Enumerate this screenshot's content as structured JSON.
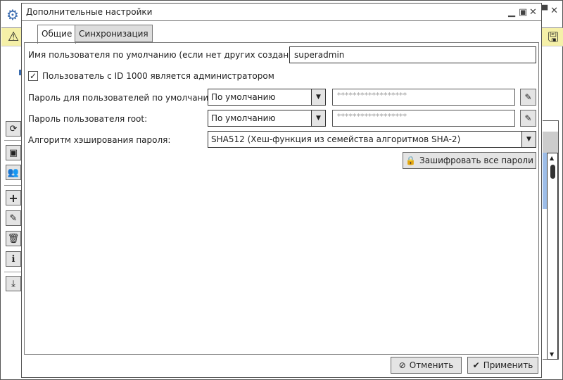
{
  "background_app": {
    "icons": [
      "gear-icon",
      "warning-icon",
      "save-lock-icon"
    ],
    "toolbar": [
      "refresh-icon",
      "contact-card-icon",
      "users-icon",
      "plus-icon",
      "edit-icon",
      "trash-icon",
      "info-icon",
      "download-icon"
    ],
    "highlight_color": "#f5f0a8"
  },
  "dialog": {
    "title": "Дополнительные настройки",
    "tabs": [
      {
        "label": "Общие",
        "active": true
      },
      {
        "label": "Синхронизация",
        "active": false
      }
    ],
    "general": {
      "default_user_label": "Имя пользователя по умолчанию (если нет других созданных):",
      "default_user_value": "superadmin",
      "admin_checkbox_label": "Пользователь с ID 1000 является администратором",
      "admin_checkbox_checked": true,
      "default_password_label": "Пароль для пользователей по умолчанию:",
      "default_password_mode": "По умолчанию",
      "default_password_value": "******************",
      "root_password_label": "Пароль пользователя root:",
      "root_password_mode": "По умолчанию",
      "root_password_value": "******************",
      "hash_label": "Алгоритм хэширования пароля:",
      "hash_value": "SHA512 (Хеш-функция из семейства алгоритмов SHA-2)",
      "encrypt_button": "Зашифровать все пароли"
    },
    "cancel_button": "Отменить",
    "apply_button": "Применить"
  }
}
